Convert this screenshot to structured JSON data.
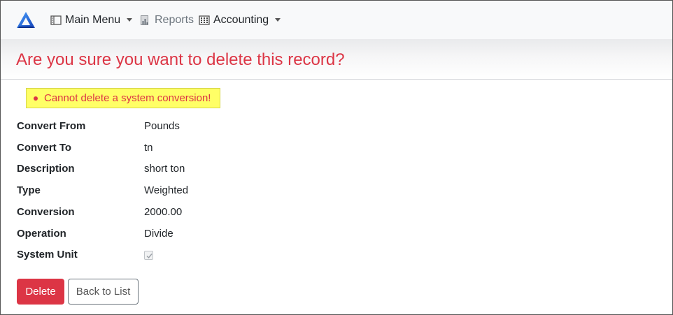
{
  "navbar": {
    "brand_icon": "triangle-logo-icon",
    "items": [
      {
        "label": "Main Menu",
        "icon": "menu-list-icon",
        "dropdown": true
      },
      {
        "label": "Reports",
        "icon": "bar-chart-icon",
        "dropdown": false
      },
      {
        "label": "Accounting",
        "icon": "ledger-grid-icon",
        "dropdown": true
      }
    ]
  },
  "page": {
    "title": "Are you sure you want to delete this record?"
  },
  "alert": {
    "message": "Cannot delete a system conversion!",
    "background": "#ffff66",
    "color": "#dc3545"
  },
  "details": [
    {
      "label": "Convert From",
      "value": "Pounds"
    },
    {
      "label": "Convert To",
      "value": "tn"
    },
    {
      "label": "Description",
      "value": "short ton"
    },
    {
      "label": "Type",
      "value": "Weighted"
    },
    {
      "label": "Conversion",
      "value": "2000.00"
    },
    {
      "label": "Operation",
      "value": "Divide"
    },
    {
      "label": "System Unit",
      "checked": true,
      "disabled": true
    }
  ],
  "buttons": {
    "delete": "Delete",
    "back": "Back to List"
  },
  "colors": {
    "danger": "#dc3545",
    "brand": "#1f6fd6",
    "navbar_bg": "#f8f9fa"
  }
}
